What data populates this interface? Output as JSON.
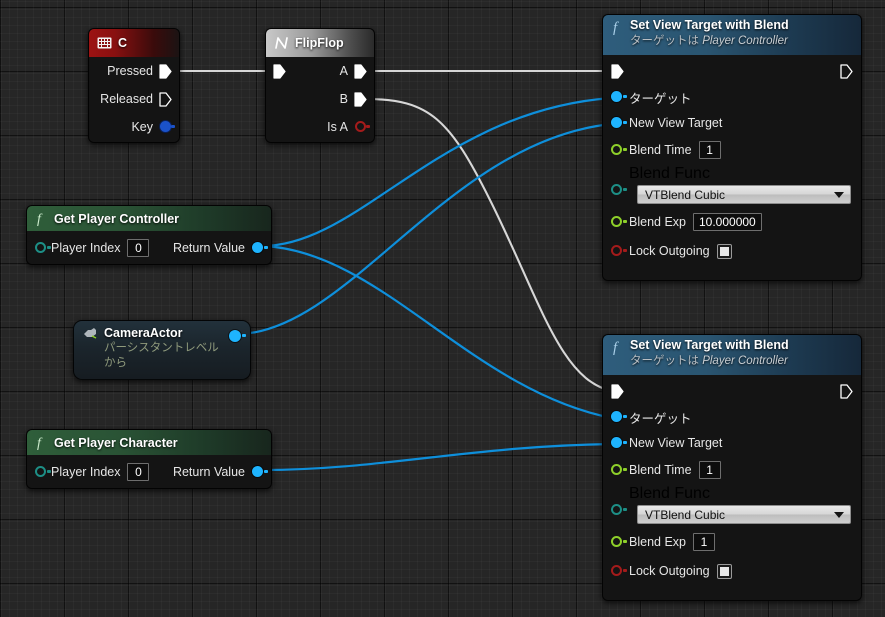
{
  "app": {
    "view": "blueprint-graph",
    "background": "#262626"
  },
  "colors": {
    "wire_exec": "#d7d7d7",
    "wire_object": "#0e8fdb",
    "pin_object": "#1eb4ff",
    "pin_float": "#8ed02a",
    "pin_enum": "#1d8f86",
    "pin_bool": "#a41b1b",
    "node_body": "#141414",
    "header_event": "#9c1212",
    "header_function": "#2e5d7c",
    "header_pure": "#2f5e3a",
    "header_macro": "#c9c9c9"
  },
  "nodes": [
    {
      "id": "key-c-event",
      "title": "C",
      "icon": "keyboard-icon",
      "header_style": "event",
      "outputs": [
        {
          "label": "Pressed",
          "pin": "exec-filled"
        },
        {
          "label": "Released",
          "pin": "exec-hollow"
        },
        {
          "label": "Key",
          "pin": "object-filled"
        }
      ]
    },
    {
      "id": "flipflop",
      "title": "FlipFlop",
      "icon": "macro-icon",
      "header_style": "macro",
      "inputs": [
        {
          "label": "",
          "pin": "exec-filled"
        }
      ],
      "outputs": [
        {
          "label": "A",
          "pin": "exec-filled"
        },
        {
          "label": "B",
          "pin": "exec-filled"
        },
        {
          "label": "Is A",
          "pin": "bool-hollow"
        }
      ]
    },
    {
      "id": "get-player-controller",
      "title": "Get Player Controller",
      "icon": "function-icon",
      "header_style": "pure",
      "inputs": [
        {
          "label": "Player Index",
          "pin": "int-hollow",
          "value": "0"
        }
      ],
      "outputs": [
        {
          "label": "Return Value",
          "pin": "object-filled"
        }
      ]
    },
    {
      "id": "camera-actor-ref",
      "title": "CameraActor",
      "icon": "actor-icon",
      "header_style": "reference",
      "subtitle_line1": "パーシスタントレベル",
      "subtitle_line2": "から",
      "outputs": [
        {
          "label": "",
          "pin": "object-filled"
        }
      ]
    },
    {
      "id": "get-player-character",
      "title": "Get Player Character",
      "icon": "function-icon",
      "header_style": "pure",
      "inputs": [
        {
          "label": "Player Index",
          "pin": "int-hollow",
          "value": "0"
        }
      ],
      "outputs": [
        {
          "label": "Return Value",
          "pin": "object-filled"
        }
      ]
    },
    {
      "id": "set-view-target-1",
      "title": "Set View Target with Blend",
      "subtitle_prefix": "ターゲットは",
      "subtitle_target": "Player Controller",
      "icon": "function-icon",
      "header_style": "function",
      "rows": [
        {
          "label": "ターゲット",
          "pin": "object-filled"
        },
        {
          "label": "New View Target",
          "pin": "object-filled"
        },
        {
          "label": "Blend Time",
          "pin": "float-hollow",
          "value": "1"
        },
        {
          "label": "Blend Func",
          "pin": "enum-hollow",
          "value": "VTBlend Cubic",
          "widget": "dropdown"
        },
        {
          "label": "Blend Exp",
          "pin": "float-hollow",
          "value": "10.000000"
        },
        {
          "label": "Lock Outgoing",
          "pin": "bool-hollow",
          "widget": "checkbox",
          "checked": false
        }
      ]
    },
    {
      "id": "set-view-target-2",
      "title": "Set View Target with Blend",
      "subtitle_prefix": "ターゲットは",
      "subtitle_target": "Player Controller",
      "icon": "function-icon",
      "header_style": "function",
      "rows": [
        {
          "label": "ターゲット",
          "pin": "object-filled"
        },
        {
          "label": "New View Target",
          "pin": "object-filled"
        },
        {
          "label": "Blend Time",
          "pin": "float-hollow",
          "value": "1"
        },
        {
          "label": "Blend Func",
          "pin": "enum-hollow",
          "value": "VTBlend Cubic",
          "widget": "dropdown"
        },
        {
          "label": "Blend Exp",
          "pin": "float-hollow",
          "value": "1"
        },
        {
          "label": "Lock Outgoing",
          "pin": "bool-hollow",
          "widget": "checkbox",
          "checked": false
        }
      ]
    }
  ],
  "labels": {
    "pressed": "Pressed",
    "released": "Released",
    "key": "Key",
    "flipflop_a": "A",
    "flipflop_b": "B",
    "flipflop_isa": "Is A",
    "player_index": "Player Index",
    "return_value": "Return Value",
    "target_jp": "ターゲット",
    "new_view_target": "New View Target",
    "blend_time": "Blend Time",
    "blend_func": "Blend Func",
    "blend_exp": "Blend Exp",
    "lock_outgoing": "Lock Outgoing",
    "subtitle_prefix": "ターゲットは",
    "subtitle_target": "Player Controller",
    "vtblend_cubic": "VTBlend Cubic",
    "zero": "0",
    "one": "1",
    "ten_float": "10.000000",
    "camera_actor": "CameraActor",
    "persistent_level_1": "パーシスタントレベル",
    "persistent_level_2": "から",
    "node_c": "C",
    "node_flipflop": "FlipFlop",
    "node_gpc": "Get Player Controller",
    "node_gpchar": "Get Player Character",
    "node_svtb": "Set View Target with Blend"
  }
}
